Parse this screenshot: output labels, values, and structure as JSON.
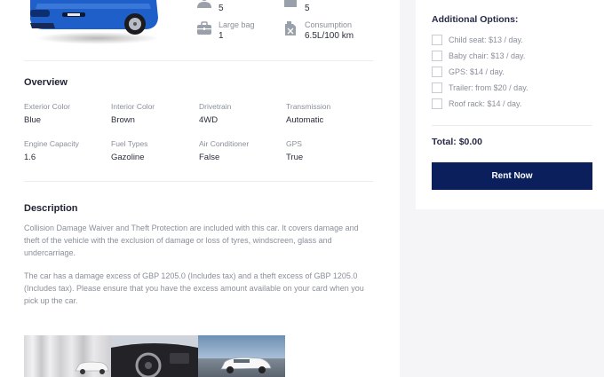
{
  "specs": {
    "top_left_value": "5",
    "top_right_value": "5",
    "large_bag_label": "Large bag",
    "large_bag_value": "1",
    "consumption_label": "Consumption",
    "consumption_value": "6.5L/100 km"
  },
  "overview": {
    "title": "Overview",
    "items": [
      {
        "label": "Exterior Color",
        "value": "Blue"
      },
      {
        "label": "Interior Color",
        "value": "Brown"
      },
      {
        "label": "Drivetrain",
        "value": "4WD"
      },
      {
        "label": "Transmission",
        "value": "Automatic"
      },
      {
        "label": "Engine Capacity",
        "value": "1.6"
      },
      {
        "label": "Fuel Types",
        "value": "Gazoline"
      },
      {
        "label": "Air Conditioner",
        "value": "False"
      },
      {
        "label": "GPS",
        "value": "True"
      }
    ]
  },
  "description": {
    "title": "Description",
    "paragraph1": "Collision Damage Waiver and Theft Protection are included with this car. It covers damage and theft of the vehicle with the exclusion of damage or loss of tyres, windscreen, glass and undercarriage.",
    "paragraph2": "The car has a damage excess of GBP 1205.0 (Includes tax) and a theft excess of GBP 1205.0 (Includes tax). Please ensure that you have the excess amount available on your card when you pick up the car."
  },
  "options": {
    "title": "Additional Options:",
    "items": [
      {
        "label": "Child seat: $13 / day.",
        "checked": false
      },
      {
        "label": "Baby chair: $13 / day.",
        "checked": false
      },
      {
        "label": "GPS: $14 / day.",
        "checked": false
      },
      {
        "label": "Trailer: from $20 / day.",
        "checked": false
      },
      {
        "label": "Roof rack: $14 / day.",
        "checked": false
      }
    ]
  },
  "total": "Total: $0.00",
  "rent_button": "Rent Now",
  "colors": {
    "primary": "#0b1f5c",
    "car_body": "#1f5fc9",
    "muted_text": "#8b8f9a",
    "side_background": "#f5f5f7"
  },
  "icons": [
    "person-icon",
    "door-icon",
    "suitcase-icon",
    "fuel-can-icon"
  ]
}
